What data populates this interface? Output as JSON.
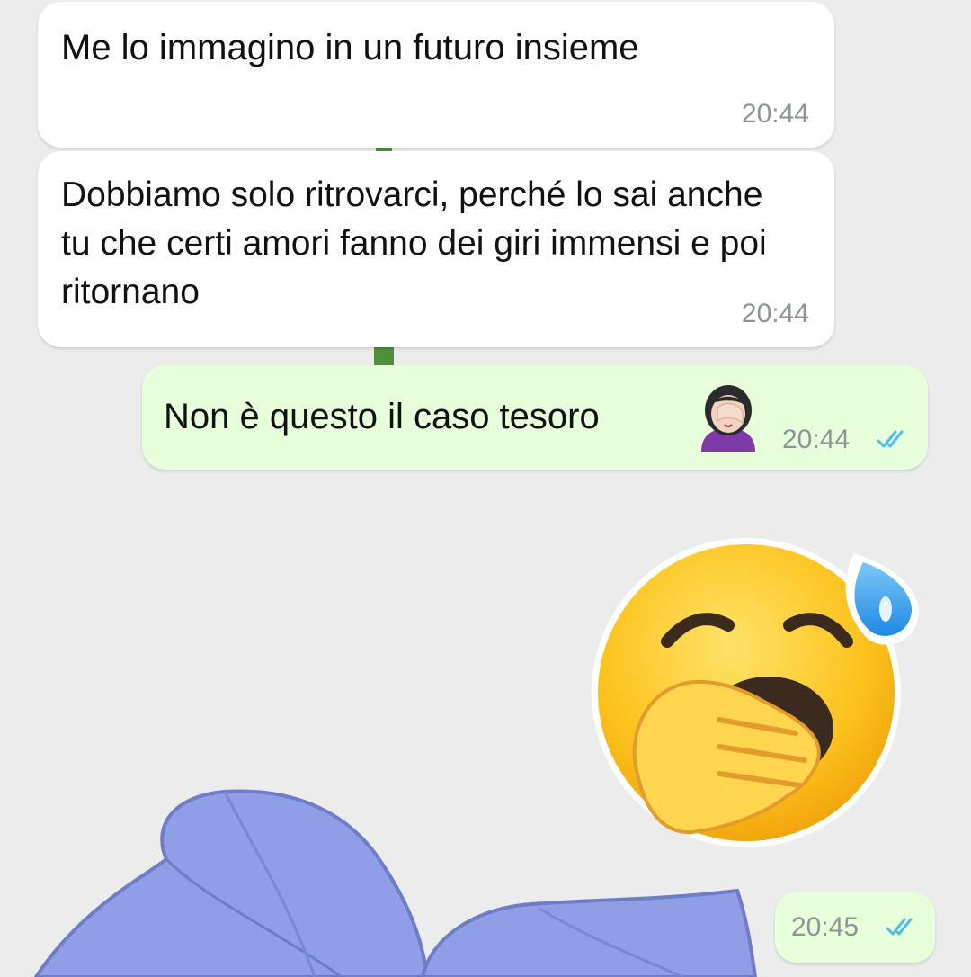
{
  "chat": {
    "messages": [
      {
        "direction": "incoming",
        "text": "Me lo immagino in un futuro insieme",
        "time": "20:44"
      },
      {
        "direction": "incoming",
        "text": "Dobbiamo solo ritrovarci, perché lo sai anche tu che certi amori fanno dei giri immensi e poi ritornano",
        "time": "20:44"
      },
      {
        "direction": "outgoing",
        "text": "Non è questo il caso tesoro",
        "emoji": "woman-facepalming-icon",
        "time": "20:44",
        "status": "read"
      },
      {
        "direction": "outgoing",
        "sticker": "yawning-face-with-sweat-drop-icon",
        "time": "20:45",
        "status": "read"
      }
    ]
  },
  "colors": {
    "incoming_bubble": "#ffffff",
    "outgoing_bubble": "#e7ffdb",
    "read_ticks": "#53bdeb",
    "timestamp": "#8d9598"
  }
}
